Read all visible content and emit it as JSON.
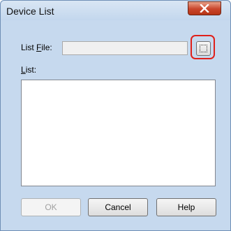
{
  "window": {
    "title": "Device List"
  },
  "fields": {
    "list_file_label_prefix": "List ",
    "list_file_label_accel": "F",
    "list_file_label_suffix": "ile:",
    "list_file_value": "",
    "list_label_accel": "L",
    "list_label_suffix": "ist:"
  },
  "icons": {
    "close": "close-icon",
    "browse": "browse-dotted-icon"
  },
  "colors": {
    "highlight": "#e0201a",
    "close_button": "#c9452b"
  },
  "buttons": {
    "ok": "OK",
    "cancel": "Cancel",
    "help": "Help"
  }
}
